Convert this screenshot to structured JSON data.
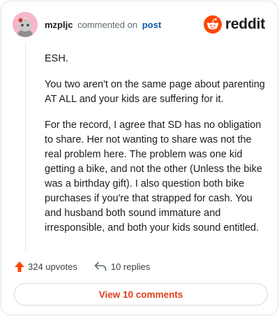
{
  "comment": {
    "username": "mzpljc",
    "action_text": "commented on",
    "target_link": "post",
    "paragraphs": [
      "ESH.",
      "You two aren't on the same page about parenting AT ALL and your kids are suffering for it.",
      "For the record, I agree that SD has no obligation to share. Her not wanting to share was not the real problem here. The problem was one kid getting a bike, and not the other (Unless the bike was a birthday gift). I also question both bike purchases if you're that strapped for cash. You and husband both sound immature and irresponsible, and both your kids sound entitled."
    ]
  },
  "brand": {
    "name": "reddit",
    "accent": "#ff4500"
  },
  "actions": {
    "upvotes_label": "324 upvotes",
    "replies_label": "10 replies",
    "view_comments_label": "View 10 comments"
  },
  "icons": [
    "snoo-avatar",
    "reddit-logo",
    "upvote-arrow-icon",
    "reply-arrow-icon"
  ]
}
